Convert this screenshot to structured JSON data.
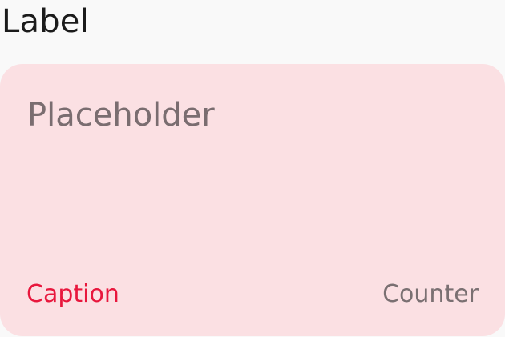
{
  "field": {
    "label": "Label",
    "placeholder": "Placeholder",
    "value": "",
    "caption": "Caption",
    "counter": "Counter"
  },
  "colors": {
    "page_background": "#f9f9f9",
    "field_background": "#fbe0e3",
    "label_text": "#1b1b1b",
    "placeholder_text": "#7a6d70",
    "caption_error": "#e8173d",
    "counter_text": "#7a7072"
  }
}
